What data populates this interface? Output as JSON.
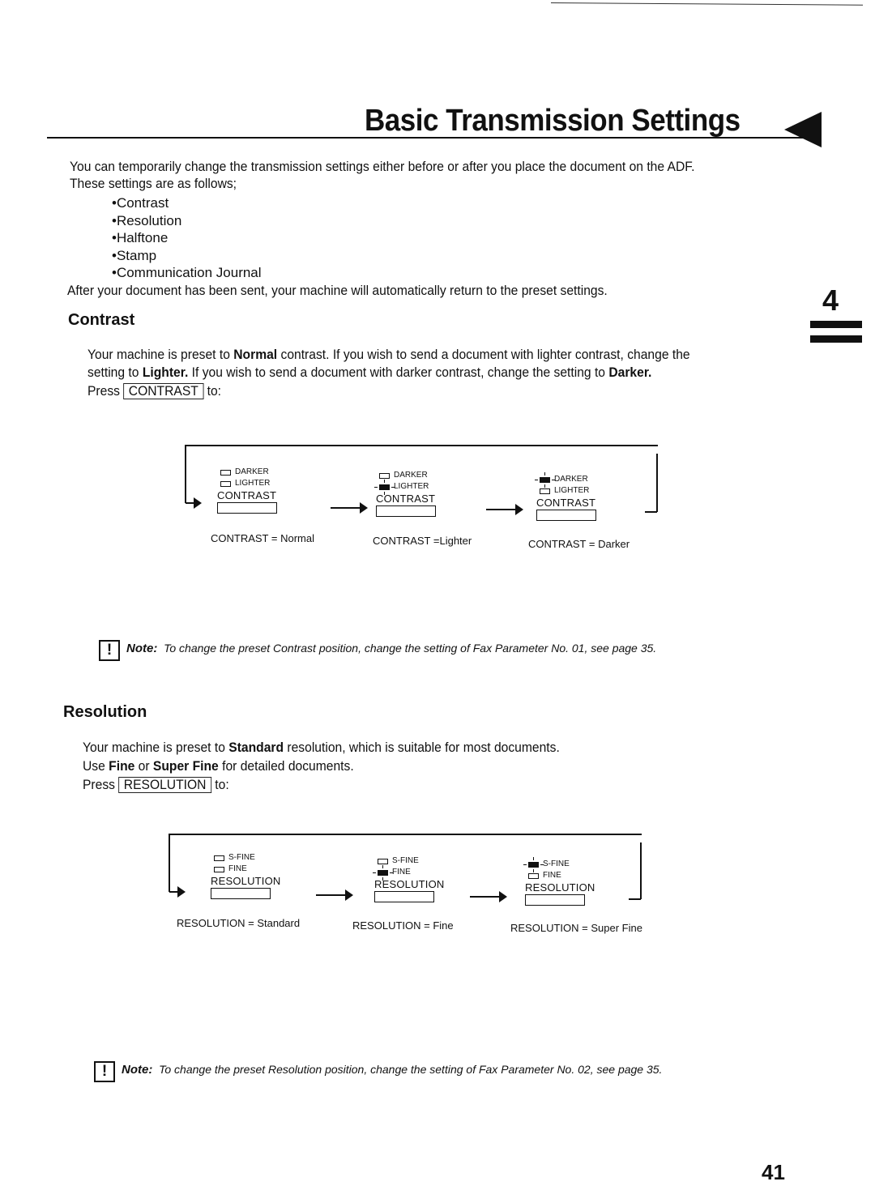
{
  "header": {
    "title": "Basic Transmission Settings",
    "chapter_number": "4"
  },
  "intro": {
    "line1": "You can temporarily change the transmission settings either before or after you place the document on the ADF.",
    "line2": "These settings are as follows;",
    "bullets": [
      "Contrast",
      "Resolution",
      "Halftone",
      "Stamp",
      "Communication Journal"
    ],
    "after": "After your document has been sent, your machine will automatically return to the preset settings."
  },
  "contrast": {
    "heading": "Contrast",
    "p1_a": "Your machine is preset to ",
    "p1_b": "Normal",
    "p1_c": " contrast.  If you wish to send a document with lighter contrast, change the",
    "p2_a": "setting to ",
    "p2_b": "Lighter.",
    "p2_c": "  If you wish to send a document with darker contrast, change the setting to ",
    "p2_d": "Darker.",
    "press": "Press",
    "key": "CONTRAST",
    "to": "to:",
    "panels": [
      {
        "top_led": "DARKER",
        "bottom_led": "LIGHTER",
        "button": "CONTRAST",
        "lit": "none",
        "caption": "CONTRAST = Normal"
      },
      {
        "top_led": "DARKER",
        "bottom_led": "LIGHTER",
        "button": "CONTRAST",
        "lit": "bottom",
        "caption": "CONTRAST =Lighter"
      },
      {
        "top_led": "DARKER",
        "bottom_led": "LIGHTER",
        "button": "CONTRAST",
        "lit": "top",
        "caption": "CONTRAST = Darker"
      }
    ],
    "note_label": "Note:",
    "note_text": "To change the preset Contrast position, change the setting of Fax Parameter No. 01, see page 35."
  },
  "resolution": {
    "heading": "Resolution",
    "p1_a": "Your machine is preset to ",
    "p1_b": "Standard",
    "p1_c": " resolution, which is suitable for most documents.",
    "p2_a": "Use ",
    "p2_b": "Fine",
    "p2_c": " or ",
    "p2_d": "Super Fine",
    "p2_e": " for detailed documents.",
    "press": "Press",
    "key": "RESOLUTION",
    "to": "to:",
    "panels": [
      {
        "top_led": "S-FINE",
        "bottom_led": "FINE",
        "button": "RESOLUTION",
        "lit": "none",
        "caption": "RESOLUTION = Standard"
      },
      {
        "top_led": "S-FINE",
        "bottom_led": "FINE",
        "button": "RESOLUTION",
        "lit": "bottom",
        "caption": "RESOLUTION = Fine"
      },
      {
        "top_led": "S-FINE",
        "bottom_led": "FINE",
        "button": "RESOLUTION",
        "lit": "top",
        "caption": "RESOLUTION = Super Fine"
      }
    ],
    "note_label": "Note:",
    "note_text": "To change the preset Resolution position, change the setting of Fax Parameter No. 02, see page 35."
  },
  "footer": {
    "page_number": "41"
  }
}
